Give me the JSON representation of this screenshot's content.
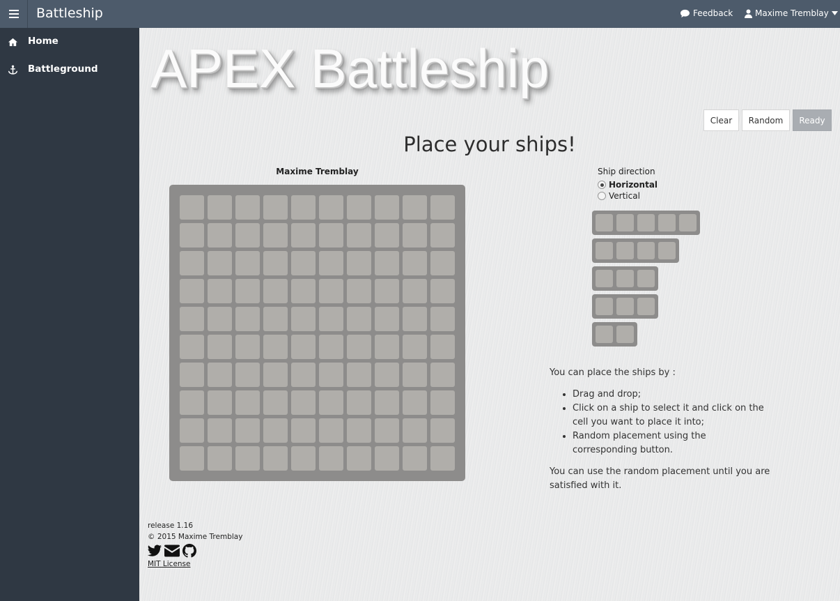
{
  "topbar": {
    "app_title": "Battleship",
    "feedback_label": "Feedback",
    "user_name": "Maxime Tremblay"
  },
  "sidebar": {
    "items": [
      {
        "label": "Home",
        "icon": "home-icon"
      },
      {
        "label": "Battleground",
        "icon": "anchor-icon"
      }
    ]
  },
  "main": {
    "banner": "APEX Battleship",
    "buttons": {
      "clear": "Clear",
      "random": "Random",
      "ready": "Ready"
    },
    "headline": "Place your ships!",
    "board": {
      "player_name": "Maxime Tremblay",
      "rows": 10,
      "cols": 10
    },
    "ship_direction": {
      "label": "Ship direction",
      "options": [
        "Horizontal",
        "Vertical"
      ],
      "selected": "Horizontal"
    },
    "ships": [
      5,
      4,
      3,
      3,
      2
    ],
    "instructions": {
      "intro": "You can place the ships by :",
      "items": [
        "Drag and drop;",
        "Click on a ship to select it and click on the cell you want to place it into;",
        "Random placement using the corresponding button."
      ],
      "outro": "You can use the random placement until you are satisfied with it."
    }
  },
  "footer": {
    "release": "release 1.16",
    "copyright": "© 2015 Maxime Tremblay",
    "license": "MIT License",
    "socials": [
      "twitter-icon",
      "envelope-icon",
      "github-icon"
    ]
  },
  "colors": {
    "topbar": "#4d5b6b",
    "sidebar": "#2f3843",
    "board_frame": "#8d8c8b",
    "cell": "#b0aeaa",
    "ready_button": "#a9adb2"
  }
}
